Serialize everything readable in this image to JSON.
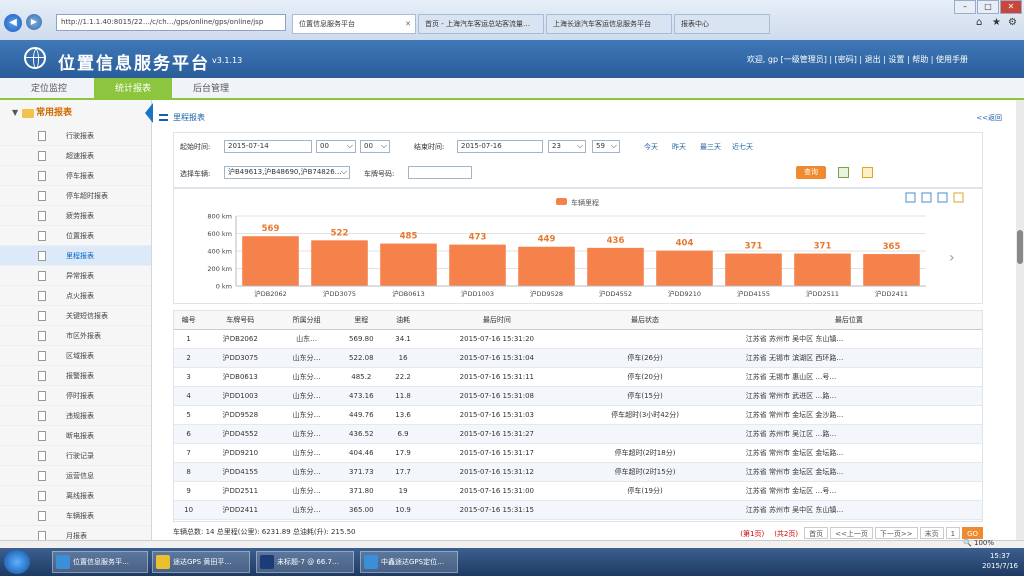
{
  "browser": {
    "address": "http://1.1.1.40:8015/22…/c/ch…/gps/online/gps/online/jsp",
    "tabs": [
      {
        "label": "位置信息服务平台",
        "active": true
      },
      {
        "label": "首页 - 上海汽车客运总站客流量…",
        "active": false
      },
      {
        "label": "上海长途汽车客运信息服务平台",
        "active": false
      },
      {
        "label": "报表中心",
        "active": false
      }
    ],
    "win_controls": [
      "–",
      "□",
      "✕"
    ]
  },
  "app": {
    "title": "位置信息服务平台",
    "version": "v3.1.13",
    "user_bar": "欢迎, gp [一级管理员] | [密码] | 退出 | 设置 | 帮助 | 使用手册"
  },
  "main_nav": [
    {
      "label": "定位监控",
      "active": false
    },
    {
      "label": "统计报表",
      "active": true
    },
    {
      "label": "后台管理",
      "active": false
    }
  ],
  "sidebar": {
    "group": "常用报表",
    "items": [
      "行驶报表",
      "超速报表",
      "停车报表",
      "停车超时报表",
      "疲劳报表",
      "位置报表",
      "里程报表",
      "异常报表",
      "点火报表",
      "关键短信报表",
      "市区外报表",
      "区域报表",
      "报警报表",
      "停时报表",
      "违规报表",
      "断电报表",
      "行驶记录",
      "运营信息",
      "离线报表",
      "车辆报表",
      "月报表"
    ],
    "active_index": 6
  },
  "content": {
    "title": "里程报表",
    "back_label": "<<返回",
    "filter": {
      "start_label": "起始时间:",
      "start_date": "2015-07-14",
      "start_hour": "00",
      "start_min": "00",
      "end_label": "结束时间:",
      "end_date": "2015-07-16",
      "end_hour": "23",
      "end_min": "59",
      "quick": [
        "今天",
        "昨天",
        "最三天",
        "近七天"
      ],
      "vehicle_label": "选择车辆:",
      "vehicle_value": "沪B49613,沪B48690,沪B74826…",
      "plate_label": "车牌号码:",
      "plate_value": "",
      "query_label": "查询"
    },
    "table": {
      "headers": [
        "编号",
        "车牌号码",
        "所属分组",
        "里程",
        "油耗",
        "最后时间",
        "最后状态",
        "最后位置"
      ],
      "rows": [
        [
          "1",
          "沪DB2062",
          "山东…",
          "569.80",
          "34.1",
          "2015-07-16 15:31:20",
          "",
          "江苏省 苏州市 吴中区 东山镇…"
        ],
        [
          "2",
          "沪DD3075",
          "山东分…",
          "522.08",
          "16",
          "2015-07-16 15:31:04",
          "停车(26分)",
          "江苏省 无锡市 滨湖区 西环路…"
        ],
        [
          "3",
          "沪DB0613",
          "山东分…",
          "485.2",
          "22.2",
          "2015-07-16 15:31:11",
          "停车(20分)",
          "江苏省 无锡市 惠山区 …号…"
        ],
        [
          "4",
          "沪DD1003",
          "山东分…",
          "473.16",
          "11.8",
          "2015-07-16 15:31:08",
          "停车(15分)",
          "江苏省 常州市 武进区 …路…"
        ],
        [
          "5",
          "沪DD9528",
          "山东分…",
          "449.76",
          "13.6",
          "2015-07-16 15:31:03",
          "停车超时(3小时42分)",
          "江苏省 常州市 金坛区 金沙路…"
        ],
        [
          "6",
          "沪DD4552",
          "山东分…",
          "436.52",
          "6.9",
          "2015-07-16 15:31:27",
          "",
          "江苏省 苏州市 吴江区 …路…"
        ],
        [
          "7",
          "沪DD9210",
          "山东分…",
          "404.46",
          "17.9",
          "2015-07-16 15:31:17",
          "停车超时(2时18分)",
          "江苏省 常州市 金坛区 金坛路…"
        ],
        [
          "8",
          "沪DD4155",
          "山东分…",
          "371.73",
          "17.7",
          "2015-07-16 15:31:12",
          "停车超时(2时15分)",
          "江苏省 常州市 金坛区 金坛路…"
        ],
        [
          "9",
          "沪DD2511",
          "山东分…",
          "371.80",
          "19",
          "2015-07-16 15:31:00",
          "停车(19分)",
          "江苏省 常州市 金坛区 …号…"
        ],
        [
          "10",
          "沪DD2411",
          "山东分…",
          "365.00",
          "10.9",
          "2015-07-16 15:31:15",
          "",
          "江苏省 苏州市 吴中区 东山镇…"
        ]
      ]
    },
    "footer_summary": "车辆总数: 14 总里程(公里): 6231.89 总油耗(升): 215.50",
    "pager": [
      "(第1页)",
      "(共2页)",
      "首页",
      "<<上一页",
      "下一页>>",
      "末页",
      "1",
      "GO"
    ]
  },
  "chart_data": {
    "type": "bar",
    "legend": "车辆里程",
    "categories": [
      "沪DB2062",
      "沪DD3075",
      "沪DB0613",
      "沪DD1003",
      "沪DD9528",
      "沪DD4552",
      "沪DD9210",
      "沪DD4155",
      "沪DD2511",
      "沪DD2411"
    ],
    "values": [
      569,
      522,
      485,
      473,
      449,
      436,
      404,
      371,
      371,
      365
    ],
    "yticks": [
      "800 km",
      "600 km",
      "400 km",
      "200 km",
      "0 km"
    ],
    "ylim": [
      0,
      800
    ],
    "bar_color": "#f5824a",
    "label_color": "#e87830"
  },
  "status": {
    "zoom": "100%"
  },
  "taskbar": {
    "tasks": [
      "位置信息服务平…",
      "途达GPS 黄田平…",
      "未标题-7 @ 66.7…",
      "中鑫途达GPS定位…"
    ],
    "time": "15:37",
    "date": "2015/7/16"
  }
}
